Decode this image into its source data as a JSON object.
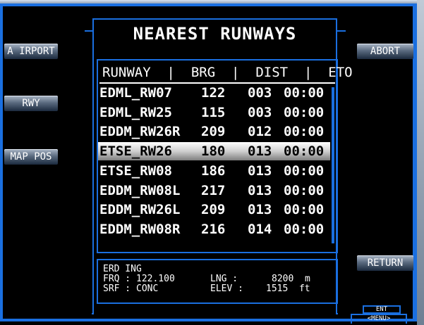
{
  "title": "NEAREST RUNWAYS",
  "left_buttons": [
    "A IRPORT",
    "RWY",
    "MAP POS"
  ],
  "right_buttons": {
    "abort": "ABORT",
    "return": "RETURN"
  },
  "list": {
    "header": "RUNWAY  |  BRG  |  DIST  |  ETO",
    "selected_index": 3,
    "rows": [
      {
        "runway": "EDML_RW07",
        "brg": "122",
        "dist": "003",
        "eto": "00:00"
      },
      {
        "runway": "EDML_RW25",
        "brg": "115",
        "dist": "003",
        "eto": "00:00"
      },
      {
        "runway": "EDDM_RW26R",
        "brg": "209",
        "dist": "012",
        "eto": "00:00"
      },
      {
        "runway": "ETSE_RW26",
        "brg": "180",
        "dist": "013",
        "eto": "00:00"
      },
      {
        "runway": "ETSE_RW08",
        "brg": "186",
        "dist": "013",
        "eto": "00:00"
      },
      {
        "runway": "EDDM_RW08L",
        "brg": "217",
        "dist": "013",
        "eto": "00:00"
      },
      {
        "runway": "EDDM_RW26L",
        "brg": "209",
        "dist": "013",
        "eto": "00:00"
      },
      {
        "runway": "EDDM_RW08R",
        "brg": "216",
        "dist": "014",
        "eto": "00:00"
      }
    ]
  },
  "info": {
    "name": "ERD ING",
    "frq_label": "FRQ :",
    "frq_value": "122.100",
    "srf_label": "SRF :",
    "srf_value": "CONC",
    "lng_label": "LNG :",
    "lng_value": "8200  m",
    "elev_label": "ELEV :",
    "elev_value": "1515  ft"
  },
  "softkeys": {
    "ent": "ENT",
    "menu": "<MENU>"
  },
  "colors": {
    "frame": "#1a6fe0",
    "text": "#ffffff",
    "background": "#000000",
    "selected": "#d8d8d8"
  }
}
